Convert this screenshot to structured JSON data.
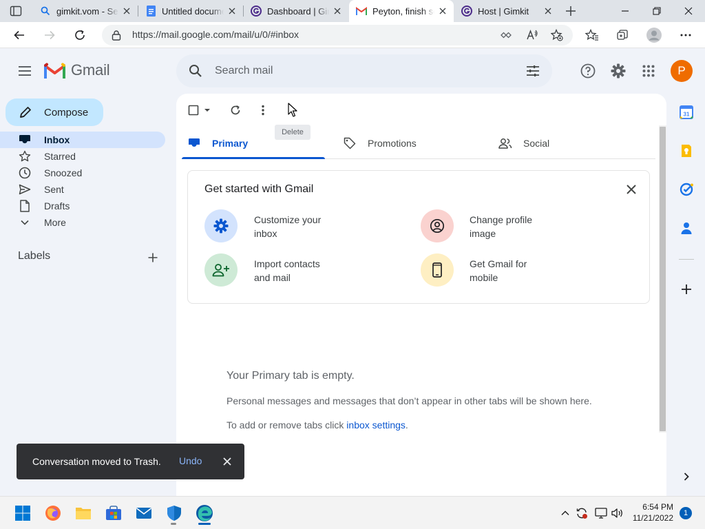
{
  "browser": {
    "tabs": [
      {
        "title": "gimkit.vom - Search",
        "icon": "search-icon",
        "active": false
      },
      {
        "title": "Untitled document",
        "icon": "docs-icon",
        "active": false
      },
      {
        "title": "Dashboard | Gimkit",
        "icon": "gimkit-icon",
        "active": false
      },
      {
        "title": "Peyton, finish setting up",
        "icon": "gmail-icon",
        "active": true
      },
      {
        "title": "Host | Gimkit",
        "icon": "gimkit-icon",
        "active": false
      }
    ],
    "url": "https://mail.google.com/mail/u/0/#inbox"
  },
  "gmail": {
    "product_name": "Gmail",
    "search_placeholder": "Search mail",
    "avatar_letter": "P",
    "accent": "#0b57d0",
    "compose_label": "Compose",
    "nav": [
      {
        "label": "Inbox",
        "icon": "inbox-icon",
        "selected": true
      },
      {
        "label": "Starred",
        "icon": "star-icon",
        "selected": false
      },
      {
        "label": "Snoozed",
        "icon": "clock-icon",
        "selected": false
      },
      {
        "label": "Sent",
        "icon": "send-icon",
        "selected": false
      },
      {
        "label": "Drafts",
        "icon": "draft-icon",
        "selected": false
      },
      {
        "label": "More",
        "icon": "chevron-down-icon",
        "selected": false
      }
    ],
    "labels_heading": "Labels",
    "toolbar_tooltip": "Delete",
    "category_tabs": [
      {
        "label": "Primary",
        "icon": "inbox-icon",
        "selected": true
      },
      {
        "label": "Promotions",
        "icon": "tag-icon",
        "selected": false
      },
      {
        "label": "Social",
        "icon": "people-icon",
        "selected": false
      }
    ],
    "get_started": {
      "title": "Get started with Gmail",
      "tiles": [
        {
          "line1": "Customize your",
          "line2": "inbox",
          "icon": "gear-icon",
          "color": "#d3e3fd"
        },
        {
          "line1": "Change profile",
          "line2": "image",
          "icon": "profile-icon",
          "color": "#fad2cf"
        },
        {
          "line1": "Import contacts",
          "line2": "and mail",
          "icon": "add-person-icon",
          "color": "#ceead6"
        },
        {
          "line1": "Get Gmail for",
          "line2": "mobile",
          "icon": "phone-icon",
          "color": "#feefc3"
        }
      ]
    },
    "empty_state": {
      "title": "Your Primary tab is empty.",
      "body": "Personal messages and messages that don’t appear in other tabs will be shown here.",
      "hint_prefix": "To add or remove tabs click ",
      "hint_link": "inbox settings",
      "hint_suffix": "."
    },
    "snackbar": {
      "message": "Conversation moved to Trash.",
      "action": "Undo"
    }
  },
  "taskbar": {
    "time": "6:54 PM",
    "date": "11/21/2022",
    "notification_count": "1"
  }
}
